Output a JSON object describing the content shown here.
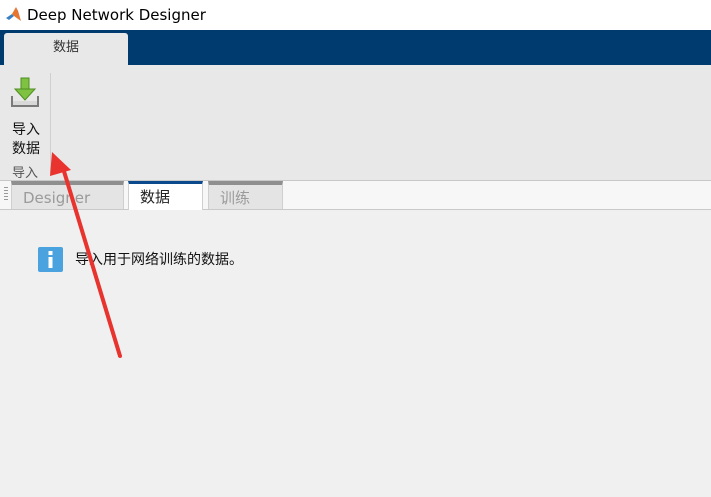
{
  "window": {
    "title": "Deep Network Designer"
  },
  "ribbon": {
    "tabs": [
      {
        "label": "数据"
      }
    ],
    "toolstrip": {
      "import_button": {
        "label_line1": "导入",
        "label_line2": "数据",
        "icon": "import-data-icon"
      },
      "group_label": "导入"
    }
  },
  "document_tabs": [
    {
      "label": "Designer",
      "active": false
    },
    {
      "label": "数据",
      "active": true
    },
    {
      "label": "训练",
      "active": false
    }
  ],
  "main": {
    "info_message": "导入用于网络训练的数据。",
    "info_icon": "info-icon"
  },
  "colors": {
    "ribbon_tab_strip": "#003b70",
    "toolstrip": "#e8e8e8",
    "active_tab_accent": "#0a4a8c",
    "annotation_arrow": "#e8332e",
    "info_icon": "#4aa3df"
  }
}
